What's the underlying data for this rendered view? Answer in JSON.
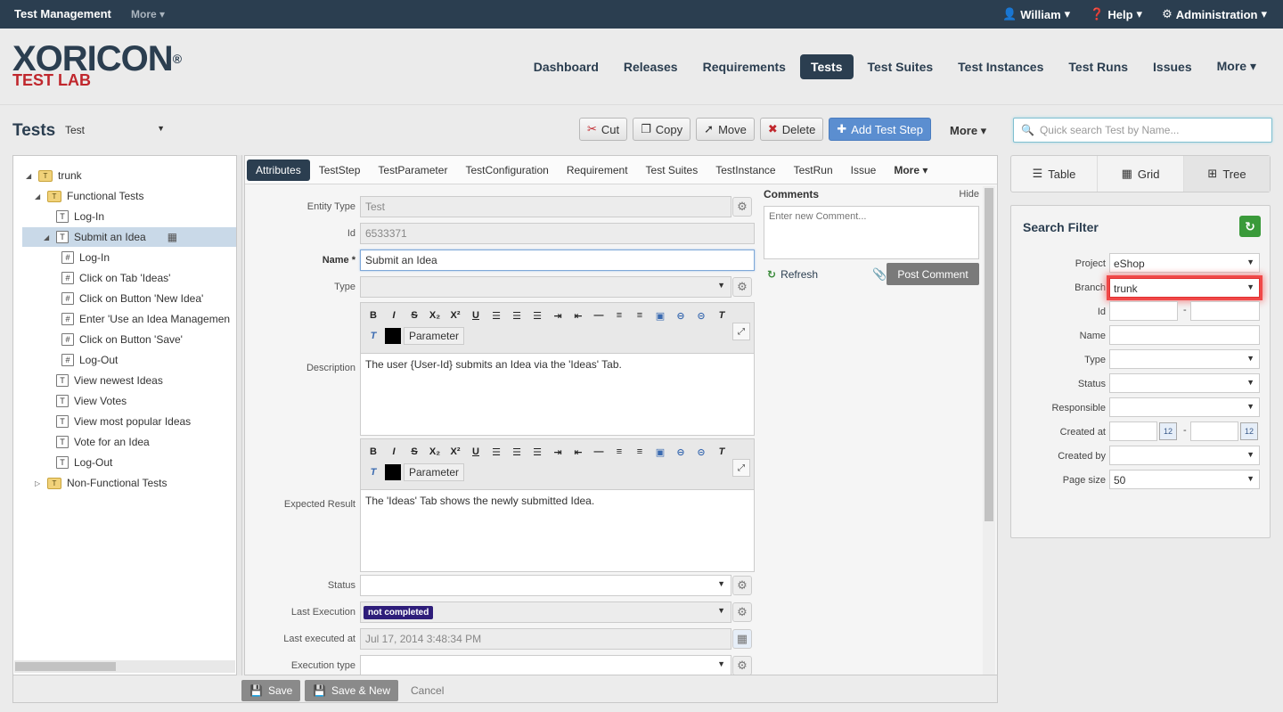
{
  "topbar": {
    "app_title": "Test Management",
    "more": "More",
    "user": "William",
    "help": "Help",
    "admin": "Administration"
  },
  "logo": {
    "line1": "XORICON",
    "line2": "TEST LAB",
    "reg": "®"
  },
  "nav": {
    "items": [
      "Dashboard",
      "Releases",
      "Requirements",
      "Tests",
      "Test Suites",
      "Test Instances",
      "Test Runs",
      "Issues",
      "More"
    ],
    "active": "Tests"
  },
  "page": {
    "title": "Tests",
    "type_select": "Test"
  },
  "toolbar": {
    "cut": "Cut",
    "copy": "Copy",
    "move": "Move",
    "delete": "Delete",
    "add_step": "Add Test Step",
    "more": "More"
  },
  "search": {
    "placeholder": "Quick search Test by Name..."
  },
  "tree": {
    "nodes": [
      {
        "label": "trunk",
        "kind": "folder",
        "level": 0,
        "toggle": "open"
      },
      {
        "label": "Functional Tests",
        "kind": "folder",
        "level": 1,
        "toggle": "open"
      },
      {
        "label": "Log-In",
        "kind": "test",
        "level": 2
      },
      {
        "label": "Submit an Idea",
        "kind": "test",
        "level": 2,
        "toggle": "open",
        "selected": true
      },
      {
        "label": "Log-In",
        "kind": "step",
        "level": 3
      },
      {
        "label": "Click on Tab 'Ideas'",
        "kind": "step",
        "level": 3
      },
      {
        "label": "Click on Button 'New Idea'",
        "kind": "step",
        "level": 3
      },
      {
        "label": "Enter 'Use an Idea Managemen",
        "kind": "step",
        "level": 3
      },
      {
        "label": "Click on Button 'Save'",
        "kind": "step",
        "level": 3
      },
      {
        "label": "Log-Out",
        "kind": "step",
        "level": 3
      },
      {
        "label": "View newest Ideas",
        "kind": "test",
        "level": 2
      },
      {
        "label": "View Votes",
        "kind": "test",
        "level": 2
      },
      {
        "label": "View most popular Ideas",
        "kind": "test",
        "level": 2
      },
      {
        "label": "Vote for an Idea",
        "kind": "test",
        "level": 2
      },
      {
        "label": "Log-Out",
        "kind": "test",
        "level": 2
      },
      {
        "label": "Non-Functional Tests",
        "kind": "folder",
        "level": 1,
        "toggle": "closed"
      }
    ]
  },
  "tabs": {
    "items": [
      "Attributes",
      "TestStep",
      "TestParameter",
      "TestConfiguration",
      "Requirement",
      "Test Suites",
      "TestInstance",
      "TestRun",
      "Issue",
      "More"
    ],
    "active": "Attributes"
  },
  "form": {
    "entity_type_label": "Entity Type",
    "entity_type_value": "Test",
    "id_label": "Id",
    "id_value": "6533371",
    "name_label": "Name",
    "name_required": "*",
    "name_value": "Submit an Idea",
    "type_label": "Type",
    "description_label": "Description",
    "description_value": "The user {User-Id} submits an Idea via the 'Ideas' Tab.",
    "expected_label": "Expected Result",
    "expected_value": "The 'Ideas' Tab shows the newly submitted Idea.",
    "parameter_btn": "Parameter",
    "status_label": "Status",
    "last_exec_label": "Last Execution",
    "last_exec_badge": "not completed",
    "last_exec_at_label": "Last executed at",
    "last_exec_at_value": "Jul 17, 2014 3:48:34 PM",
    "exec_type_label": "Execution type"
  },
  "comments": {
    "title": "Comments",
    "hide": "Hide",
    "placeholder": "Enter new Comment...",
    "refresh": "Refresh",
    "post": "Post Comment"
  },
  "footer": {
    "save": "Save",
    "save_new": "Save & New",
    "cancel": "Cancel"
  },
  "views": {
    "table": "Table",
    "grid": "Grid",
    "tree": "Tree",
    "active": "Tree"
  },
  "filter": {
    "title": "Search Filter",
    "project_label": "Project",
    "project_value": "eShop",
    "branch_label": "Branch",
    "branch_value": "trunk",
    "id_label": "Id",
    "name_label": "Name",
    "type_label": "Type",
    "status_label": "Status",
    "responsible_label": "Responsible",
    "created_at_label": "Created at",
    "created_by_label": "Created by",
    "page_size_label": "Page size",
    "page_size_value": "50",
    "range_sep": "-"
  }
}
